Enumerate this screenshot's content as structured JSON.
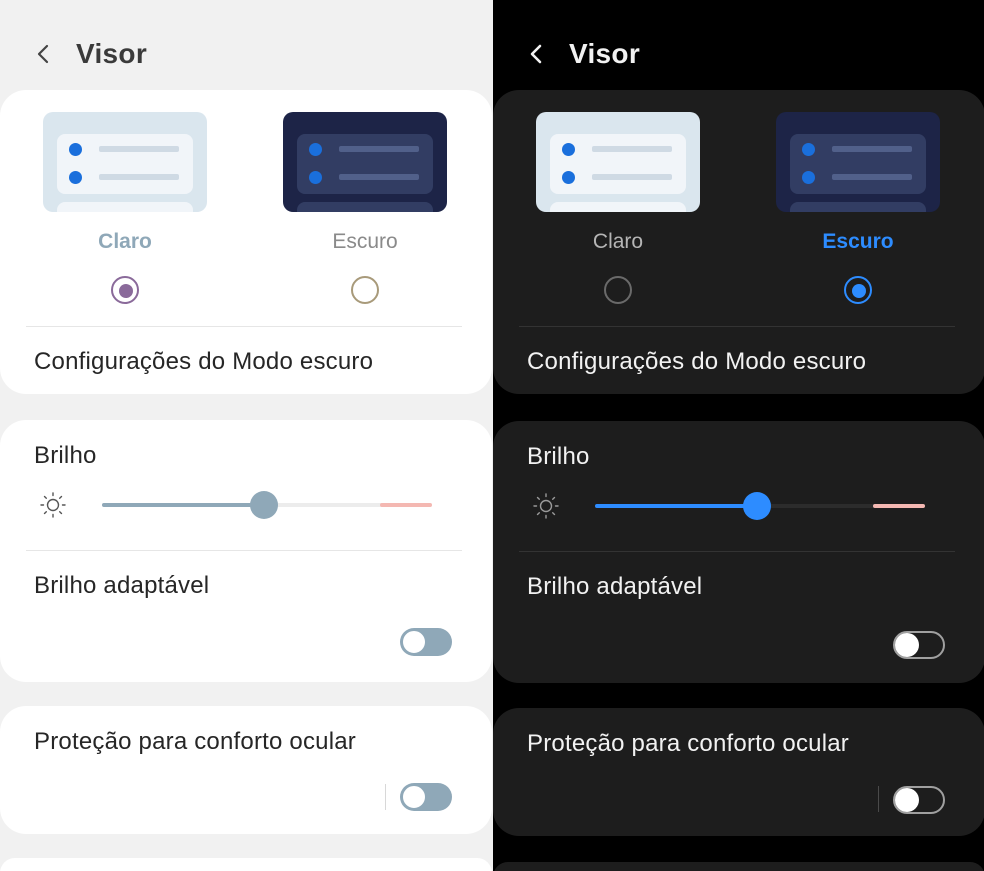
{
  "colors": {
    "light_bg": "#f1f1f1",
    "light_card": "#ffffff",
    "dark_bg": "#000000",
    "dark_card": "#1d1d1d",
    "light_accent": "#8fa8b8",
    "dark_accent": "#2d8cff",
    "light_radio_selected": "#8a6a9a",
    "brightness_high_segment": "#f4b8b2"
  },
  "panels": [
    {
      "theme": "light",
      "header": {
        "back_icon": "chevron-left-icon",
        "title": "Visor"
      },
      "display_mode": {
        "options": [
          {
            "label": "Claro",
            "selected": true
          },
          {
            "label": "Escuro",
            "selected": false
          }
        ],
        "settings_link": "Configurações do Modo escuro"
      },
      "brightness": {
        "label": "Brilho",
        "icon": "sun-icon",
        "level_fraction": 0.49
      },
      "adaptive_brightness": {
        "label": "Brilho adaptável",
        "on": false
      },
      "eye_comfort": {
        "label": "Proteção para conforto ocular",
        "on": false
      }
    },
    {
      "theme": "dark",
      "header": {
        "back_icon": "chevron-left-icon",
        "title": "Visor"
      },
      "display_mode": {
        "options": [
          {
            "label": "Claro",
            "selected": false
          },
          {
            "label": "Escuro",
            "selected": true
          }
        ],
        "settings_link": "Configurações do Modo escuro"
      },
      "brightness": {
        "label": "Brilho",
        "icon": "sun-icon",
        "level_fraction": 0.49
      },
      "adaptive_brightness": {
        "label": "Brilho adaptável",
        "on": false
      },
      "eye_comfort": {
        "label": "Proteção para conforto ocular",
        "on": false
      }
    }
  ]
}
